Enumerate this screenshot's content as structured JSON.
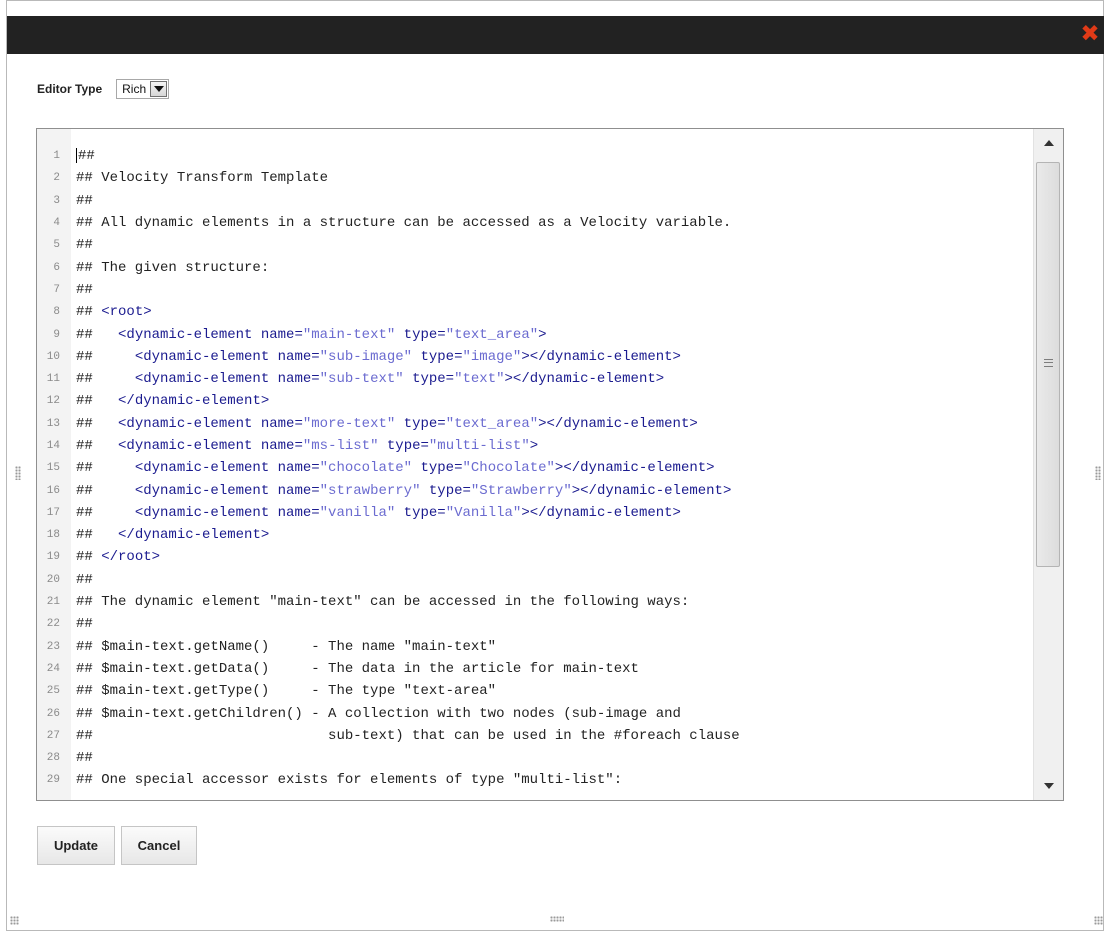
{
  "dialog": {
    "close_label": "✖"
  },
  "editor_type": {
    "label": "Editor Type",
    "selected": "Rich"
  },
  "code_lines": [
    [
      {
        "t": "##",
        "c": "plain"
      }
    ],
    [
      {
        "t": "## Velocity Transform Template",
        "c": "plain"
      }
    ],
    [
      {
        "t": "##",
        "c": "plain"
      }
    ],
    [
      {
        "t": "## All dynamic elements in a structure can be accessed as a Velocity variable.",
        "c": "plain"
      }
    ],
    [
      {
        "t": "##",
        "c": "plain"
      }
    ],
    [
      {
        "t": "## The given structure:",
        "c": "plain"
      }
    ],
    [
      {
        "t": "##",
        "c": "plain"
      }
    ],
    [
      {
        "t": "## ",
        "c": "plain"
      },
      {
        "t": "<root>",
        "c": "tag"
      }
    ],
    [
      {
        "t": "##   ",
        "c": "plain"
      },
      {
        "t": "<dynamic-element name=",
        "c": "tag"
      },
      {
        "t": "\"main-text\"",
        "c": "str"
      },
      {
        "t": " type=",
        "c": "tag"
      },
      {
        "t": "\"text_area\"",
        "c": "str"
      },
      {
        "t": ">",
        "c": "tag"
      }
    ],
    [
      {
        "t": "##     ",
        "c": "plain"
      },
      {
        "t": "<dynamic-element name=",
        "c": "tag"
      },
      {
        "t": "\"sub-image\"",
        "c": "str"
      },
      {
        "t": " type=",
        "c": "tag"
      },
      {
        "t": "\"image\"",
        "c": "str"
      },
      {
        "t": "></dynamic-element>",
        "c": "tag"
      }
    ],
    [
      {
        "t": "##     ",
        "c": "plain"
      },
      {
        "t": "<dynamic-element name=",
        "c": "tag"
      },
      {
        "t": "\"sub-text\"",
        "c": "str"
      },
      {
        "t": " type=",
        "c": "tag"
      },
      {
        "t": "\"text\"",
        "c": "str"
      },
      {
        "t": "></dynamic-element>",
        "c": "tag"
      }
    ],
    [
      {
        "t": "##   ",
        "c": "plain"
      },
      {
        "t": "</dynamic-element>",
        "c": "tag"
      }
    ],
    [
      {
        "t": "##   ",
        "c": "plain"
      },
      {
        "t": "<dynamic-element name=",
        "c": "tag"
      },
      {
        "t": "\"more-text\"",
        "c": "str"
      },
      {
        "t": " type=",
        "c": "tag"
      },
      {
        "t": "\"text_area\"",
        "c": "str"
      },
      {
        "t": "></dynamic-element>",
        "c": "tag"
      }
    ],
    [
      {
        "t": "##   ",
        "c": "plain"
      },
      {
        "t": "<dynamic-element name=",
        "c": "tag"
      },
      {
        "t": "\"ms-list\"",
        "c": "str"
      },
      {
        "t": " type=",
        "c": "tag"
      },
      {
        "t": "\"multi-list\"",
        "c": "str"
      },
      {
        "t": ">",
        "c": "tag"
      }
    ],
    [
      {
        "t": "##     ",
        "c": "plain"
      },
      {
        "t": "<dynamic-element name=",
        "c": "tag"
      },
      {
        "t": "\"chocolate\"",
        "c": "str"
      },
      {
        "t": " type=",
        "c": "tag"
      },
      {
        "t": "\"Chocolate\"",
        "c": "str"
      },
      {
        "t": "></dynamic-element>",
        "c": "tag"
      }
    ],
    [
      {
        "t": "##     ",
        "c": "plain"
      },
      {
        "t": "<dynamic-element name=",
        "c": "tag"
      },
      {
        "t": "\"strawberry\"",
        "c": "str"
      },
      {
        "t": " type=",
        "c": "tag"
      },
      {
        "t": "\"Strawberry\"",
        "c": "str"
      },
      {
        "t": "></dynamic-element>",
        "c": "tag"
      }
    ],
    [
      {
        "t": "##     ",
        "c": "plain"
      },
      {
        "t": "<dynamic-element name=",
        "c": "tag"
      },
      {
        "t": "\"vanilla\"",
        "c": "str"
      },
      {
        "t": " type=",
        "c": "tag"
      },
      {
        "t": "\"Vanilla\"",
        "c": "str"
      },
      {
        "t": "></dynamic-element>",
        "c": "tag"
      }
    ],
    [
      {
        "t": "##   ",
        "c": "plain"
      },
      {
        "t": "</dynamic-element>",
        "c": "tag"
      }
    ],
    [
      {
        "t": "## ",
        "c": "plain"
      },
      {
        "t": "</root>",
        "c": "tag"
      }
    ],
    [
      {
        "t": "##",
        "c": "plain"
      }
    ],
    [
      {
        "t": "## The dynamic element \"main-text\" can be accessed in the following ways:",
        "c": "plain"
      }
    ],
    [
      {
        "t": "##",
        "c": "plain"
      }
    ],
    [
      {
        "t": "## $main-text.getName()     - The name \"main-text\"",
        "c": "plain"
      }
    ],
    [
      {
        "t": "## $main-text.getData()     - The data in the article for main-text",
        "c": "plain"
      }
    ],
    [
      {
        "t": "## $main-text.getType()     - The type \"text-area\"",
        "c": "plain"
      }
    ],
    [
      {
        "t": "## $main-text.getChildren() - A collection with two nodes (sub-image and",
        "c": "plain"
      }
    ],
    [
      {
        "t": "##                            sub-text) that can be used in the #foreach clause",
        "c": "plain"
      }
    ],
    [
      {
        "t": "##",
        "c": "plain"
      }
    ],
    [
      {
        "t": "## One special accessor exists for elements of type \"multi-list\":",
        "c": "plain"
      }
    ]
  ],
  "buttons": {
    "update": "Update",
    "cancel": "Cancel"
  }
}
